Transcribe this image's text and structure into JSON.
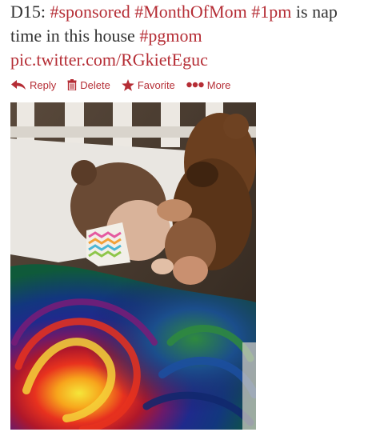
{
  "tweet": {
    "segments": [
      {
        "text": "D15: ",
        "link": false
      },
      {
        "text": "#sponsored",
        "link": true
      },
      {
        "text": " ",
        "link": false
      },
      {
        "text": "#MonthOfMom",
        "link": true
      },
      {
        "text": " ",
        "link": false
      },
      {
        "text": "#1pm",
        "link": true
      },
      {
        "text": " is nap time in this house ",
        "link": false
      },
      {
        "text": "#pgmom",
        "link": true
      },
      {
        "text": " ",
        "link": false
      },
      {
        "text": "pic.twitter.com/RGkietEguc",
        "link": true
      }
    ]
  },
  "actions": {
    "reply": {
      "label": "Reply",
      "icon": "reply-arrow-icon"
    },
    "delete": {
      "label": "Delete",
      "icon": "trash-icon"
    },
    "favorite": {
      "label": "Favorite",
      "icon": "star-icon"
    },
    "more": {
      "label": "More",
      "icon": "ellipsis-icon"
    }
  },
  "colors": {
    "link": "#b52d35",
    "text": "#333333"
  }
}
